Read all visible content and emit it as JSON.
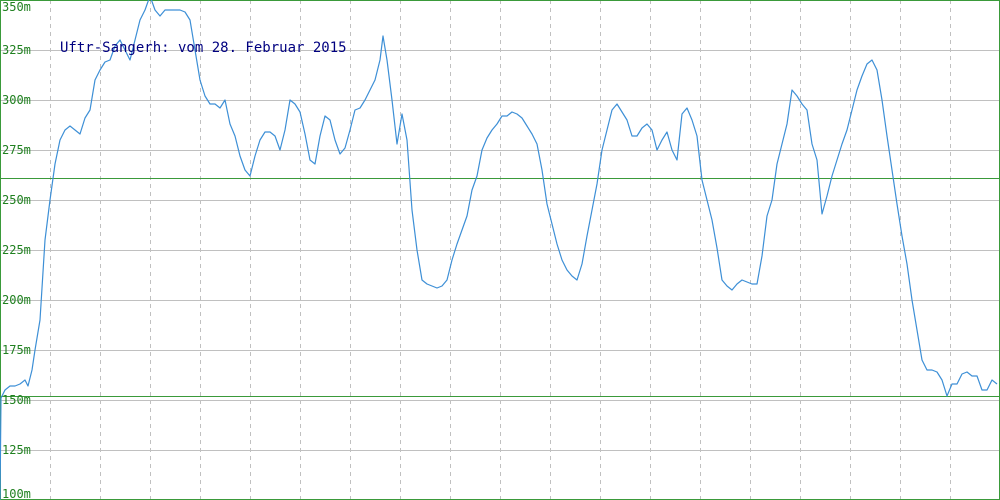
{
  "chart_data": {
    "type": "line",
    "title": "Uftr-Sangerh: vom 28. Februar 2015",
    "xlabel": "",
    "ylabel": "",
    "ylim": [
      100,
      350
    ],
    "y_ticks": [
      "100m",
      "125m",
      "150m",
      "175m",
      "200m",
      "225m",
      "250m",
      "275m",
      "300m",
      "325m",
      "350m"
    ],
    "x_gridlines": 20,
    "grid": true,
    "reference_lines": [
      {
        "value": 261,
        "color": "#3a9a3a"
      },
      {
        "value": 152,
        "color": "#3a9a3a"
      }
    ],
    "series": [
      {
        "color": "#3d8fd6",
        "points": [
          [
            0,
            100
          ],
          [
            1,
            151
          ],
          [
            5,
            155
          ],
          [
            10,
            157
          ],
          [
            15,
            157
          ],
          [
            20,
            158
          ],
          [
            25,
            160
          ],
          [
            28,
            157
          ],
          [
            32,
            165
          ],
          [
            35,
            175
          ],
          [
            40,
            190
          ],
          [
            45,
            230
          ],
          [
            50,
            250
          ],
          [
            55,
            268
          ],
          [
            60,
            280
          ],
          [
            65,
            285
          ],
          [
            70,
            287
          ],
          [
            75,
            285
          ],
          [
            80,
            283
          ],
          [
            85,
            291
          ],
          [
            90,
            295
          ],
          [
            95,
            310
          ],
          [
            100,
            315
          ],
          [
            105,
            319
          ],
          [
            110,
            320
          ],
          [
            115,
            327
          ],
          [
            120,
            330
          ],
          [
            125,
            325
          ],
          [
            130,
            320
          ],
          [
            135,
            330
          ],
          [
            140,
            340
          ],
          [
            145,
            345
          ],
          [
            150,
            352
          ],
          [
            155,
            345
          ],
          [
            160,
            342
          ],
          [
            165,
            345
          ],
          [
            170,
            345
          ],
          [
            175,
            345
          ],
          [
            180,
            345
          ],
          [
            185,
            344
          ],
          [
            190,
            340
          ],
          [
            195,
            325
          ],
          [
            200,
            310
          ],
          [
            205,
            302
          ],
          [
            210,
            298
          ],
          [
            215,
            298
          ],
          [
            220,
            296
          ],
          [
            225,
            300
          ],
          [
            230,
            288
          ],
          [
            235,
            282
          ],
          [
            240,
            272
          ],
          [
            245,
            265
          ],
          [
            250,
            262
          ],
          [
            255,
            272
          ],
          [
            260,
            280
          ],
          [
            265,
            284
          ],
          [
            270,
            284
          ],
          [
            275,
            282
          ],
          [
            280,
            275
          ],
          [
            285,
            285
          ],
          [
            290,
            300
          ],
          [
            295,
            298
          ],
          [
            300,
            294
          ],
          [
            305,
            283
          ],
          [
            310,
            270
          ],
          [
            315,
            268
          ],
          [
            320,
            282
          ],
          [
            325,
            292
          ],
          [
            330,
            290
          ],
          [
            335,
            280
          ],
          [
            340,
            273
          ],
          [
            345,
            276
          ],
          [
            350,
            285
          ],
          [
            355,
            295
          ],
          [
            360,
            296
          ],
          [
            365,
            300
          ],
          [
            370,
            305
          ],
          [
            375,
            310
          ],
          [
            380,
            320
          ],
          [
            383,
            332
          ],
          [
            387,
            320
          ],
          [
            392,
            300
          ],
          [
            397,
            278
          ],
          [
            402,
            293
          ],
          [
            407,
            280
          ],
          [
            412,
            245
          ],
          [
            417,
            225
          ],
          [
            422,
            210
          ],
          [
            427,
            208
          ],
          [
            432,
            207
          ],
          [
            437,
            206
          ],
          [
            442,
            207
          ],
          [
            447,
            210
          ],
          [
            452,
            220
          ],
          [
            457,
            228
          ],
          [
            462,
            235
          ],
          [
            467,
            242
          ],
          [
            472,
            255
          ],
          [
            477,
            262
          ],
          [
            482,
            275
          ],
          [
            487,
            281
          ],
          [
            492,
            285
          ],
          [
            497,
            288
          ],
          [
            502,
            292
          ],
          [
            507,
            292
          ],
          [
            512,
            294
          ],
          [
            517,
            293
          ],
          [
            522,
            291
          ],
          [
            527,
            287
          ],
          [
            532,
            283
          ],
          [
            537,
            278
          ],
          [
            542,
            265
          ],
          [
            547,
            248
          ],
          [
            552,
            238
          ],
          [
            557,
            228
          ],
          [
            562,
            220
          ],
          [
            567,
            215
          ],
          [
            572,
            212
          ],
          [
            577,
            210
          ],
          [
            582,
            218
          ],
          [
            587,
            232
          ],
          [
            592,
            245
          ],
          [
            597,
            258
          ],
          [
            602,
            275
          ],
          [
            607,
            285
          ],
          [
            612,
            295
          ],
          [
            617,
            298
          ],
          [
            622,
            294
          ],
          [
            627,
            290
          ],
          [
            632,
            282
          ],
          [
            637,
            282
          ],
          [
            642,
            286
          ],
          [
            647,
            288
          ],
          [
            652,
            285
          ],
          [
            657,
            275
          ],
          [
            662,
            280
          ],
          [
            667,
            284
          ],
          [
            672,
            275
          ],
          [
            677,
            270
          ],
          [
            682,
            293
          ],
          [
            687,
            296
          ],
          [
            692,
            290
          ],
          [
            697,
            282
          ],
          [
            702,
            260
          ],
          [
            707,
            250
          ],
          [
            712,
            240
          ],
          [
            717,
            226
          ],
          [
            722,
            210
          ],
          [
            727,
            207
          ],
          [
            732,
            205
          ],
          [
            737,
            208
          ],
          [
            742,
            210
          ],
          [
            747,
            209
          ],
          [
            752,
            208
          ],
          [
            757,
            208
          ],
          [
            762,
            222
          ],
          [
            767,
            242
          ],
          [
            772,
            250
          ],
          [
            777,
            268
          ],
          [
            782,
            278
          ],
          [
            787,
            288
          ],
          [
            792,
            305
          ],
          [
            797,
            302
          ],
          [
            802,
            298
          ],
          [
            807,
            295
          ],
          [
            812,
            278
          ],
          [
            817,
            270
          ],
          [
            822,
            243
          ],
          [
            827,
            252
          ],
          [
            832,
            262
          ],
          [
            837,
            270
          ],
          [
            842,
            278
          ],
          [
            847,
            285
          ],
          [
            852,
            295
          ],
          [
            857,
            305
          ],
          [
            862,
            312
          ],
          [
            867,
            318
          ],
          [
            872,
            320
          ],
          [
            877,
            315
          ],
          [
            882,
            300
          ],
          [
            887,
            282
          ],
          [
            892,
            265
          ],
          [
            897,
            248
          ],
          [
            902,
            232
          ],
          [
            907,
            218
          ],
          [
            912,
            200
          ],
          [
            917,
            185
          ],
          [
            922,
            170
          ],
          [
            927,
            165
          ],
          [
            932,
            165
          ],
          [
            937,
            164
          ],
          [
            942,
            160
          ],
          [
            947,
            152
          ],
          [
            952,
            158
          ],
          [
            957,
            158
          ],
          [
            962,
            163
          ],
          [
            967,
            164
          ],
          [
            972,
            162
          ],
          [
            977,
            162
          ],
          [
            982,
            155
          ],
          [
            987,
            155
          ],
          [
            992,
            160
          ],
          [
            997,
            158
          ]
        ]
      }
    ],
    "colors": {
      "background": "#ffffff",
      "grid": "#c0c0c0",
      "frame": "#3a9a3a",
      "tick_text": "#208020",
      "title_text": "#000080"
    }
  }
}
